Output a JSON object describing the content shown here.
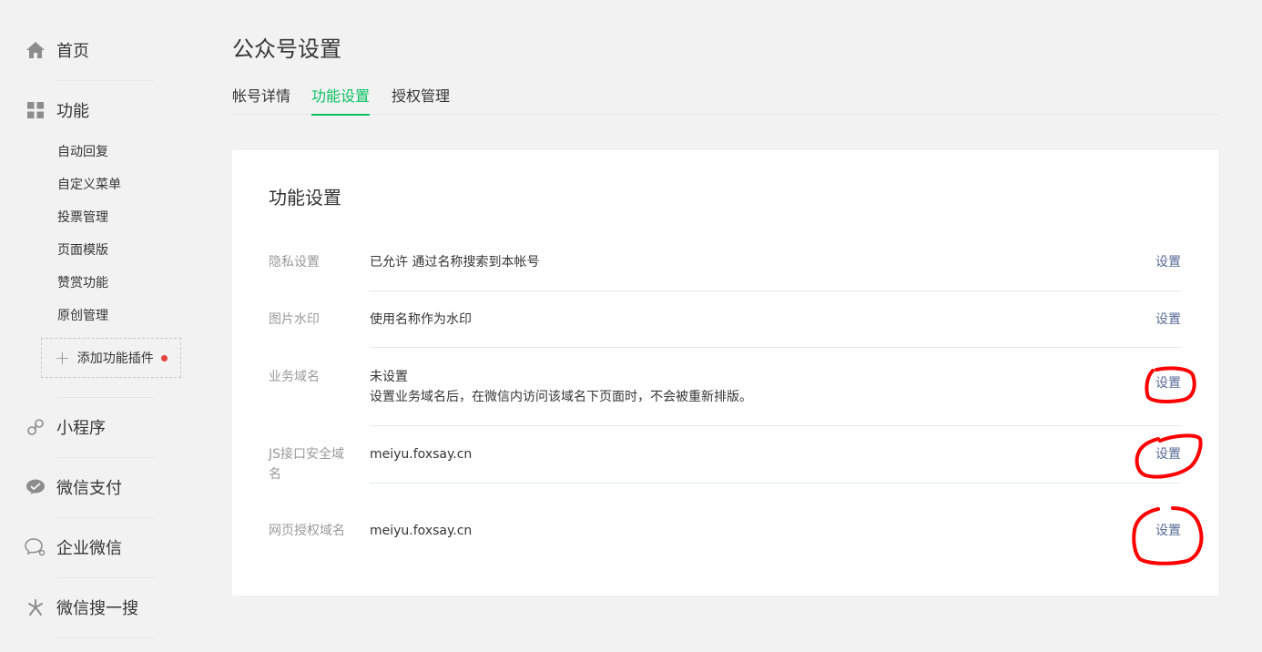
{
  "sidebar": {
    "home": "首页",
    "features": "功能",
    "sub_items": [
      "自动回复",
      "自定义菜单",
      "投票管理",
      "页面模版",
      "赞赏功能",
      "原创管理"
    ],
    "add_plugin": "添加功能插件",
    "mini_program": "小程序",
    "wechat_pay": "微信支付",
    "work_wechat": "企业微信",
    "wechat_search": "微信搜一搜"
  },
  "page": {
    "title": "公众号设置",
    "tabs": [
      "帐号详情",
      "功能设置",
      "授权管理"
    ],
    "active_tab": "功能设置"
  },
  "panel": {
    "title": "功能设置",
    "rows": [
      {
        "label": "隐私设置",
        "value": "已允许 通过名称搜索到本帐号",
        "action": "设置"
      },
      {
        "label": "图片水印",
        "value": "使用名称作为水印",
        "action": "设置"
      },
      {
        "label": "业务域名",
        "value": "未设置",
        "note": "设置业务域名后，在微信内访问该域名下页面时，不会被重新排版。",
        "action": "设置"
      },
      {
        "label": "JS接口安全域名",
        "value": "meiyu.foxsay.cn",
        "action": "设置"
      },
      {
        "label": "网页授权域名",
        "value": "meiyu.foxsay.cn",
        "action": "设置"
      }
    ]
  },
  "colors": {
    "accent_green": "#07c160",
    "link_blue": "#576b95",
    "annotation_red": "#ff0000",
    "notification_dot": "#e64340"
  }
}
